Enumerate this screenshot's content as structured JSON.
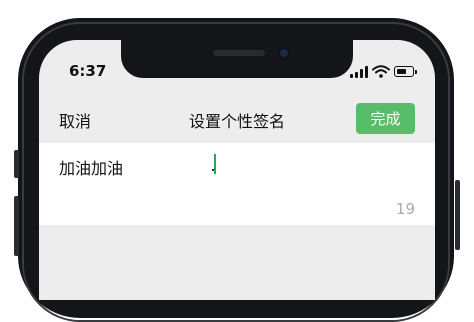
{
  "status_bar": {
    "time": "6:37",
    "icons": [
      "signal-icon",
      "wifi-icon",
      "battery-icon"
    ]
  },
  "navbar": {
    "cancel_label": "取消",
    "title": "设置个性签名",
    "done_label": "完成"
  },
  "signature": {
    "value": "加油加油",
    "remaining_count": "19"
  },
  "colors": {
    "accent": "#57bd6a",
    "background": "#ededed",
    "card": "#ffffff",
    "counter": "#aaaaaa",
    "device_frame": "#141518"
  }
}
